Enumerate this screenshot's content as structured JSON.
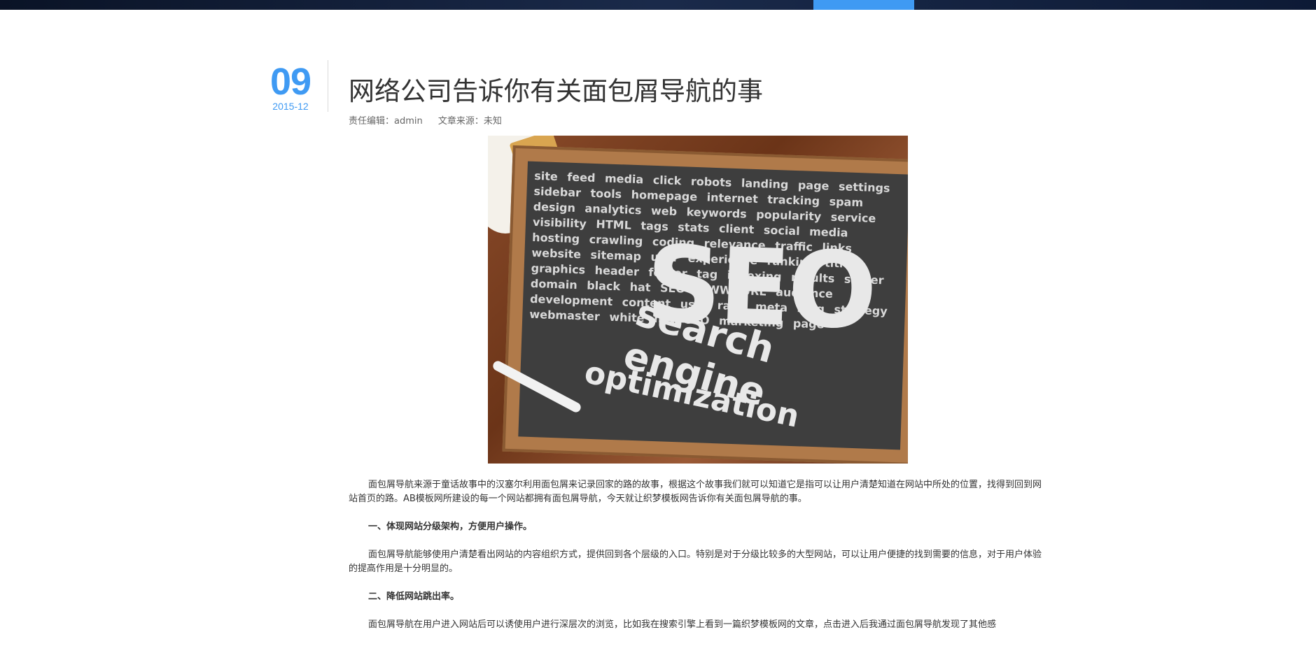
{
  "date": {
    "day": "09",
    "year_month": "2015-12"
  },
  "article": {
    "title": "网络公司告诉你有关面包屑导航的事",
    "meta": {
      "editor": "责任编辑：admin",
      "source": "文章来源：未知"
    },
    "image": {
      "words": [
        "SEO",
        "search",
        "engine",
        "optimization"
      ],
      "small_words": "site feed media click robots landing page settings sidebar tools homepage internet tracking spam design analytics web keywords popularity service visibility HTML tags stats client social media hosting crawling coding relevance traffic links website sitemap user experience ranking title graphics header footer tag indexing results spider domain black hat SEO WWW URL audience development content user rank meta blog strategy webmaster white hat SEO marketing page"
    },
    "paragraphs": [
      {
        "text": "面包屑导航来源于童话故事中的汉塞尔利用面包屑来记录回家的路的故事，根据这个故事我们就可以知道它是指可以让用户清楚知道在网站中所处的位置，找得到回到网站首页的路。AB模板网所建设的每一个网站都拥有面包屑导航，今天就让织梦模板网告诉你有关面包屑导航的事。"
      },
      {
        "text": "一、体现网站分级架构，方便用户操作。"
      },
      {
        "text": "面包屑导航能够使用户清楚看出网站的内容组织方式，提供回到各个层级的入口。特别是对于分级比较多的大型网站，可以让用户便捷的找到需要的信息，对于用户体验的提高作用是十分明显的。"
      },
      {
        "text": "二、降低网站跳出率。"
      },
      {
        "text": "面包屑导航在用户进入网站后可以诱使用户进行深层次的浏览，比如我在搜索引擎上看到一篇织梦模板网的文章，点击进入后我通过面包屑导航发现了其他感"
      }
    ]
  }
}
